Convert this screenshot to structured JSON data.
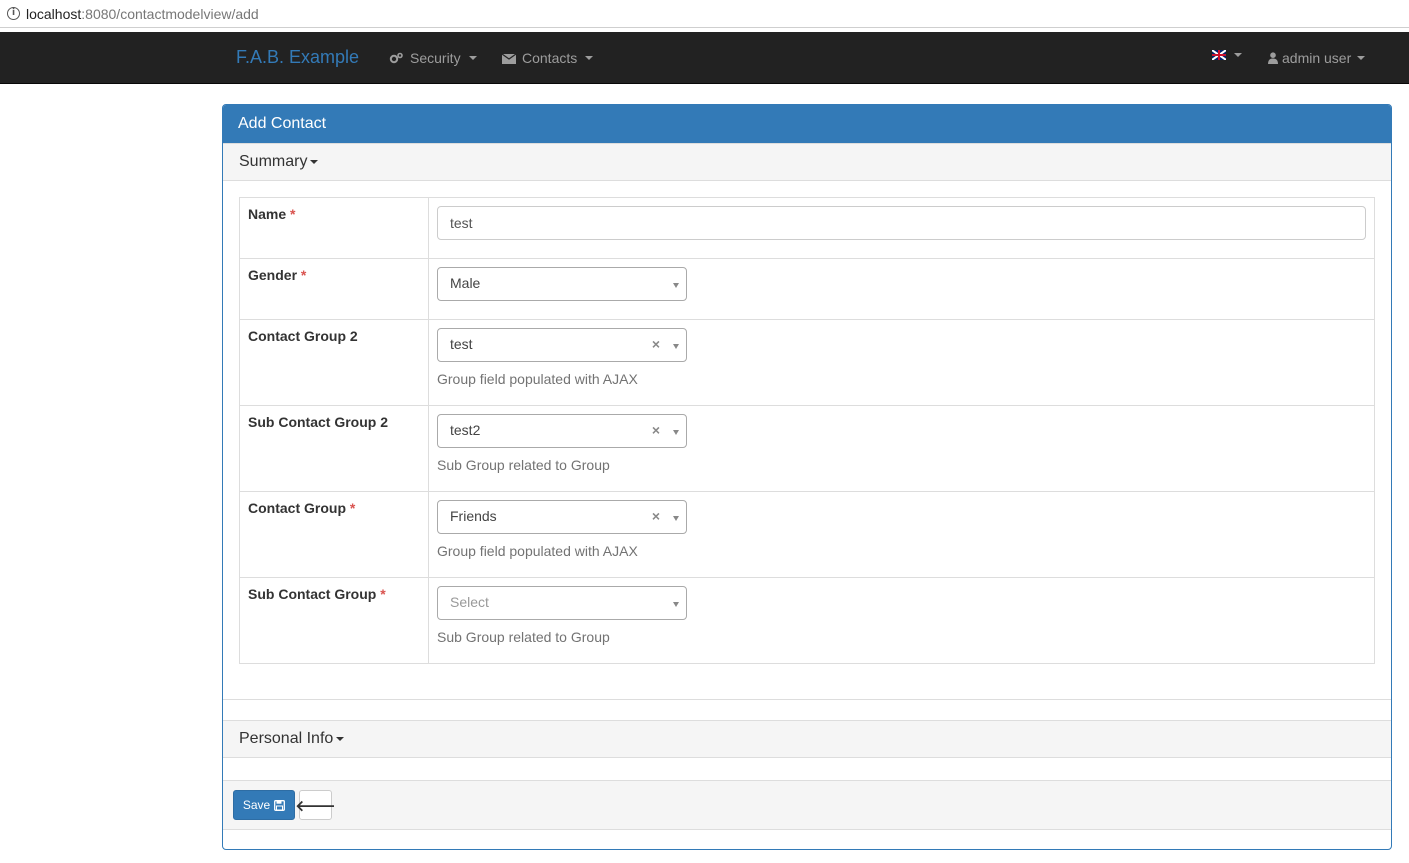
{
  "browser": {
    "url_host": "localhost",
    "url_rest": ":8080/contactmodelview/add",
    "info_icon": "i"
  },
  "navbar": {
    "brand": "F.A.B. Example",
    "menus": [
      {
        "label": "Security",
        "icon": "gears-icon"
      },
      {
        "label": "Contacts",
        "icon": "envelope-icon"
      }
    ],
    "language_icon": "uk-flag-icon",
    "user_label": "admin user"
  },
  "panel": {
    "title": "Add Contact",
    "sections": [
      {
        "title": "Summary"
      },
      {
        "title": "Personal Info"
      }
    ]
  },
  "form": {
    "required_mark": "*",
    "name": {
      "label": "Name",
      "value": "test"
    },
    "gender": {
      "label": "Gender",
      "value": "Male"
    },
    "contact_group_2": {
      "label": "Contact Group 2",
      "value": "test",
      "help": "Group field populated with AJAX",
      "clear": "×"
    },
    "sub_contact_group_2": {
      "label": "Sub Contact Group 2",
      "value": "test2",
      "help": "Sub Group related to Group",
      "clear": "×"
    },
    "contact_group": {
      "label": "Contact Group",
      "value": "Friends",
      "help": "Group field populated with AJAX",
      "clear": "×"
    },
    "sub_contact_group": {
      "label": "Sub Contact Group",
      "placeholder": "Select",
      "help": "Sub Group related to Group"
    }
  },
  "actions": {
    "save_label": "Save",
    "save_icon": "floppy-disk-icon",
    "back_icon": "arrow-left-icon",
    "back_glyph": "🡐"
  },
  "colors": {
    "primary": "#337ab7",
    "navbar": "#222222",
    "required": "#d9534f"
  }
}
